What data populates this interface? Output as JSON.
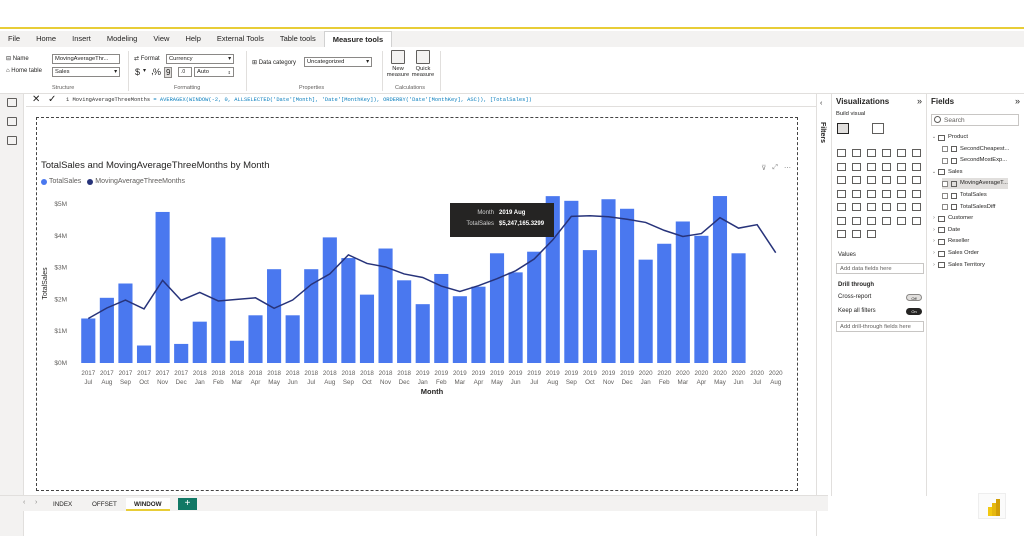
{
  "ribbon_tabs": [
    "File",
    "Home",
    "Insert",
    "Modeling",
    "View",
    "Help",
    "External Tools",
    "Table tools",
    "Measure tools"
  ],
  "ribbon": {
    "name_label": "Name",
    "name_value": "MovingAverageThr...",
    "home_table_label": "Home table",
    "home_table_value": "Sales",
    "structure_label": "Structure",
    "format_label": "Format",
    "format_value": "Currency",
    "currency_symbol": "$",
    "comma_symbol": ",",
    "percent_symbol": "%",
    "decimal_symbol": "9",
    "decimals_value": "Auto",
    "formatting_label": "Formatting",
    "data_category_label": "Data category",
    "data_category_value": "Uncategorized",
    "properties_label": "Properties",
    "new_measure_label": "New measure",
    "quick_measure_label": "Quick measure",
    "calculations_label": "Calculations"
  },
  "formula": {
    "line_number": "1",
    "name": "MovingAverageThreeMonths",
    "text": "= AVERAGEX(WINDOW(-2, 0, ALLSELECTED('Date'[Month], 'Date'[MonthKey]), ORDERBY('Date'[MonthKey], ASC)), [TotalSales])"
  },
  "chart_data": {
    "type": "bar",
    "title": "TotalSales and MovingAverageThreeMonths by Month",
    "xlabel": "Month",
    "ylabel": "TotalSales",
    "ylim": [
      0,
      5000000
    ],
    "yticks": [
      "$0M",
      "$1M",
      "$2M",
      "$3M",
      "$4M",
      "$5M"
    ],
    "ytick_values": [
      0,
      1000000,
      2000000,
      3000000,
      4000000,
      5000000
    ],
    "categories": [
      "2017 Jul",
      "2017 Aug",
      "2017 Sep",
      "2017 Oct",
      "2017 Nov",
      "2017 Dec",
      "2018 Jan",
      "2018 Feb",
      "2018 Mar",
      "2018 Apr",
      "2018 May",
      "2018 Jun",
      "2018 Jul",
      "2018 Aug",
      "2018 Sep",
      "2018 Oct",
      "2018 Nov",
      "2018 Dec",
      "2019 Jan",
      "2019 Feb",
      "2019 Mar",
      "2019 Apr",
      "2019 May",
      "2019 Jun",
      "2019 Jul",
      "2019 Aug",
      "2019 Sep",
      "2019 Oct",
      "2019 Nov",
      "2019 Dec",
      "2020 Jan",
      "2020 Feb",
      "2020 Mar",
      "2020 Apr",
      "2020 May",
      "2020 Jun",
      "2020 Jul",
      "2020 Aug"
    ],
    "series": [
      {
        "name": "TotalSales",
        "type": "bar",
        "color": "#4a78ef",
        "values": [
          1400000,
          2050000,
          2500000,
          550000,
          4750000,
          600000,
          1300000,
          3950000,
          700000,
          1500000,
          2950000,
          1500000,
          2950000,
          3950000,
          3300000,
          2150000,
          3600000,
          2600000,
          1850000,
          2800000,
          2100000,
          2400000,
          3450000,
          2850000,
          3500000,
          5247165.3299,
          5100000,
          3550000,
          5150000,
          4850000,
          3250000,
          3750000,
          4450000,
          4000000,
          5250000,
          3450000,
          null,
          null
        ]
      },
      {
        "name": "MovingAverageThreeMonths",
        "type": "line",
        "color": "#27337a",
        "values": [
          1400000,
          1730000,
          1980000,
          1700000,
          2600000,
          1970000,
          2220000,
          1950000,
          2000000,
          2050000,
          1720000,
          1980000,
          2470000,
          2800000,
          3400000,
          3130000,
          3020000,
          2800000,
          2690000,
          2420000,
          2250000,
          2430000,
          2650000,
          2900000,
          3270000,
          3870000,
          4610000,
          4630000,
          4600000,
          4520000,
          4420000,
          4170000,
          3980000,
          4070000,
          4570000,
          4240000,
          4350000,
          3470000
        ]
      }
    ],
    "tooltip": {
      "month_label": "Month",
      "month_value": "2019 Aug",
      "sales_label": "TotalSales",
      "sales_value": "$5,247,165.3299"
    }
  },
  "visualizations": {
    "title": "Visualizations",
    "build_visual": "Build visual",
    "values_label": "Values",
    "add_data_fields": "Add data fields here",
    "drill_through": "Drill through",
    "cross_report": "Cross-report",
    "cross_report_state": "Off",
    "keep_all_filters": "Keep all filters",
    "keep_all_filters_state": "On",
    "add_drill_through": "Add drill-through fields here"
  },
  "filters_label": "Filters",
  "fields": {
    "title": "Fields",
    "search_placeholder": "Search",
    "items": [
      {
        "label": "Product",
        "kind": "table",
        "indent": 0,
        "expanded": true
      },
      {
        "label": "SecondCheapest...",
        "kind": "measure",
        "indent": 1
      },
      {
        "label": "SecondMostExp...",
        "kind": "measure",
        "indent": 1
      },
      {
        "label": "Sales",
        "kind": "table",
        "indent": 0,
        "expanded": true
      },
      {
        "label": "MovingAverageT...",
        "kind": "measure",
        "indent": 1,
        "selected": true
      },
      {
        "label": "TotalSales",
        "kind": "measure",
        "indent": 1
      },
      {
        "label": "TotalSalesDiff",
        "kind": "measure",
        "indent": 1
      },
      {
        "label": "Customer",
        "kind": "table",
        "indent": 0
      },
      {
        "label": "Date",
        "kind": "table",
        "indent": 0
      },
      {
        "label": "Reseller",
        "kind": "table",
        "indent": 0
      },
      {
        "label": "Sales Order",
        "kind": "table",
        "indent": 0
      },
      {
        "label": "Sales Territory",
        "kind": "table",
        "indent": 0
      }
    ]
  },
  "page_tabs": [
    "INDEX",
    "OFFSET",
    "WINDOW"
  ],
  "active_page": "WINDOW",
  "add_page": "+",
  "accent_color": "#e8cd37"
}
